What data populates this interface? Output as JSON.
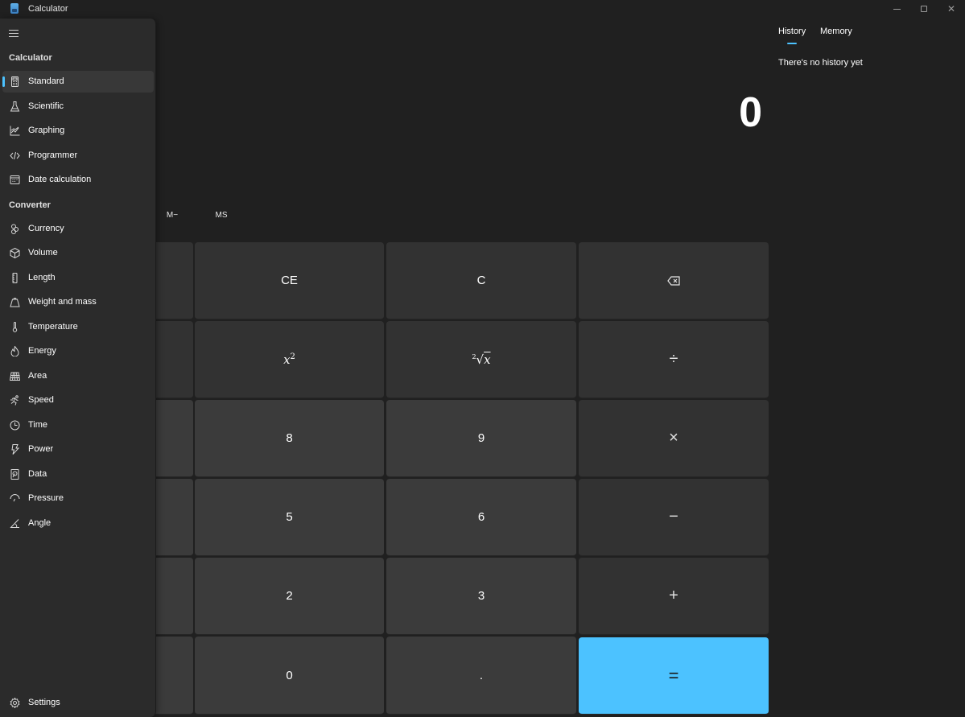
{
  "window": {
    "title": "Calculator",
    "controls": {
      "minimize": "minimize",
      "maximize": "maximize",
      "close": "close"
    }
  },
  "display": {
    "value": "0"
  },
  "memory_row": {
    "m_minus": "M−",
    "ms": "MS"
  },
  "keypad": {
    "rows": [
      [
        {
          "label": "CE",
          "type": "fn"
        },
        {
          "label": "C",
          "type": "fn"
        },
        {
          "label": "backspace",
          "type": "fn",
          "icon": "backspace-icon"
        }
      ],
      [
        {
          "label": "x²",
          "type": "fn"
        },
        {
          "label": "²√x",
          "type": "fn"
        },
        {
          "label": "÷",
          "type": "fn"
        }
      ],
      [
        {
          "label": "8",
          "type": "num"
        },
        {
          "label": "9",
          "type": "num"
        },
        {
          "label": "×",
          "type": "fn"
        }
      ],
      [
        {
          "label": "5",
          "type": "num"
        },
        {
          "label": "6",
          "type": "num"
        },
        {
          "label": "−",
          "type": "fn"
        }
      ],
      [
        {
          "label": "2",
          "type": "num"
        },
        {
          "label": "3",
          "type": "num"
        },
        {
          "label": "+",
          "type": "fn"
        }
      ],
      [
        {
          "label": "0",
          "type": "num"
        },
        {
          "label": ".",
          "type": "num"
        },
        {
          "label": "=",
          "type": "eq"
        }
      ]
    ],
    "accent_color": "#4cc2ff"
  },
  "history_pane": {
    "tabs": [
      {
        "label": "History",
        "active": true
      },
      {
        "label": "Memory",
        "active": false
      }
    ],
    "empty_message": "There's no history yet"
  },
  "nav": {
    "menu_icon": "hamburger-icon",
    "sections": [
      {
        "title": "Calculator",
        "items": [
          {
            "label": "Standard",
            "icon": "calculator-icon",
            "selected": true
          },
          {
            "label": "Scientific",
            "icon": "flask-icon"
          },
          {
            "label": "Graphing",
            "icon": "graph-icon"
          },
          {
            "label": "Programmer",
            "icon": "code-icon"
          },
          {
            "label": "Date calculation",
            "icon": "calendar-icon"
          }
        ]
      },
      {
        "title": "Converter",
        "items": [
          {
            "label": "Currency",
            "icon": "currency-icon"
          },
          {
            "label": "Volume",
            "icon": "cube-icon"
          },
          {
            "label": "Length",
            "icon": "ruler-icon"
          },
          {
            "label": "Weight and mass",
            "icon": "weight-icon"
          },
          {
            "label": "Temperature",
            "icon": "thermometer-icon"
          },
          {
            "label": "Energy",
            "icon": "flame-icon"
          },
          {
            "label": "Area",
            "icon": "grid-icon"
          },
          {
            "label": "Speed",
            "icon": "runner-icon"
          },
          {
            "label": "Time",
            "icon": "clock-icon"
          },
          {
            "label": "Power",
            "icon": "lightning-icon"
          },
          {
            "label": "Data",
            "icon": "data-icon"
          },
          {
            "label": "Pressure",
            "icon": "gauge-icon"
          },
          {
            "label": "Angle",
            "icon": "angle-icon"
          }
        ]
      }
    ],
    "settings": {
      "label": "Settings",
      "icon": "gear-icon"
    }
  }
}
